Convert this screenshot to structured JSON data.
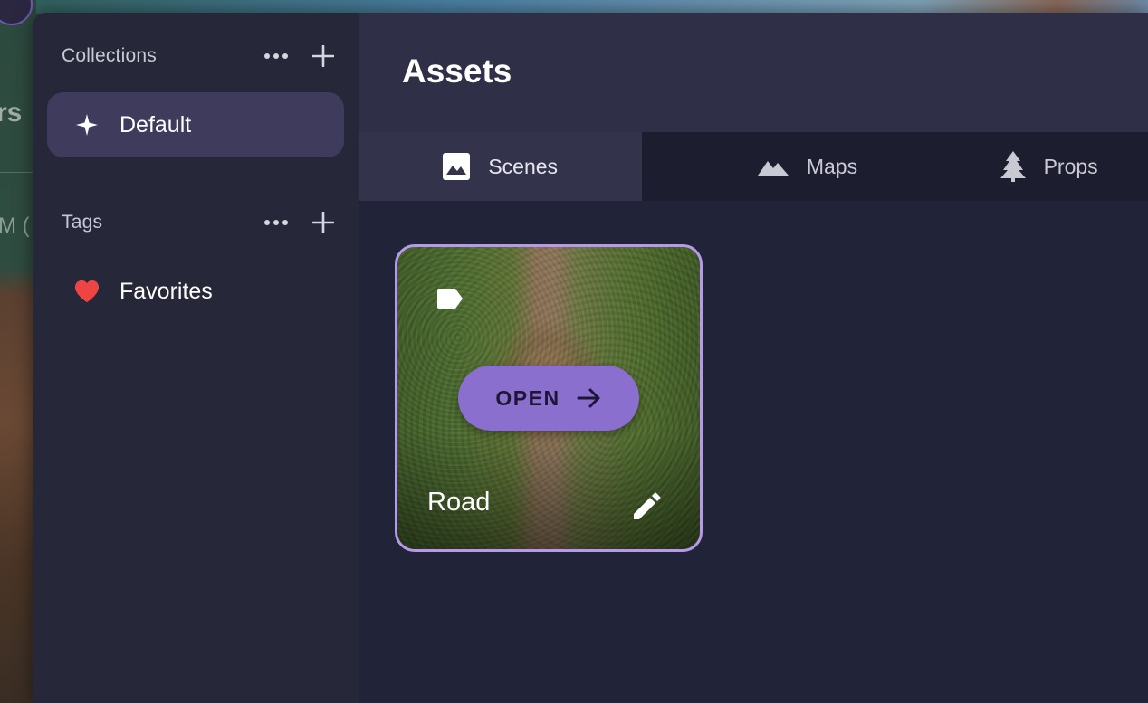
{
  "background": {
    "partial_heading": "rs",
    "partial_text": "M (",
    "accent_color": "#6a5bb0"
  },
  "sidebar": {
    "collections": {
      "title": "Collections",
      "more_icon": "more-horiz-icon",
      "add_icon": "add-icon",
      "items": [
        {
          "label": "Default",
          "icon": "sparkle-icon",
          "active": true
        }
      ]
    },
    "tags": {
      "title": "Tags",
      "more_icon": "more-horiz-icon",
      "add_icon": "add-icon",
      "items": [
        {
          "label": "Favorites",
          "icon": "heart-icon",
          "icon_color": "#ef4444"
        }
      ]
    }
  },
  "main": {
    "title": "Assets",
    "tabs": [
      {
        "label": "Scenes",
        "icon": "image-icon",
        "active": true
      },
      {
        "label": "Maps",
        "icon": "mountain-icon",
        "active": false
      },
      {
        "label": "Props",
        "icon": "tree-icon",
        "active": false
      }
    ],
    "cards": [
      {
        "title": "Road",
        "open_label": "OPEN",
        "tag_icon": "label-icon",
        "edit_icon": "pencil-icon",
        "selected": true
      }
    ]
  },
  "colors": {
    "selection_border": "#b69ae8",
    "open_button": "#8a6fcf",
    "active_nav": "#3f3b5c"
  }
}
